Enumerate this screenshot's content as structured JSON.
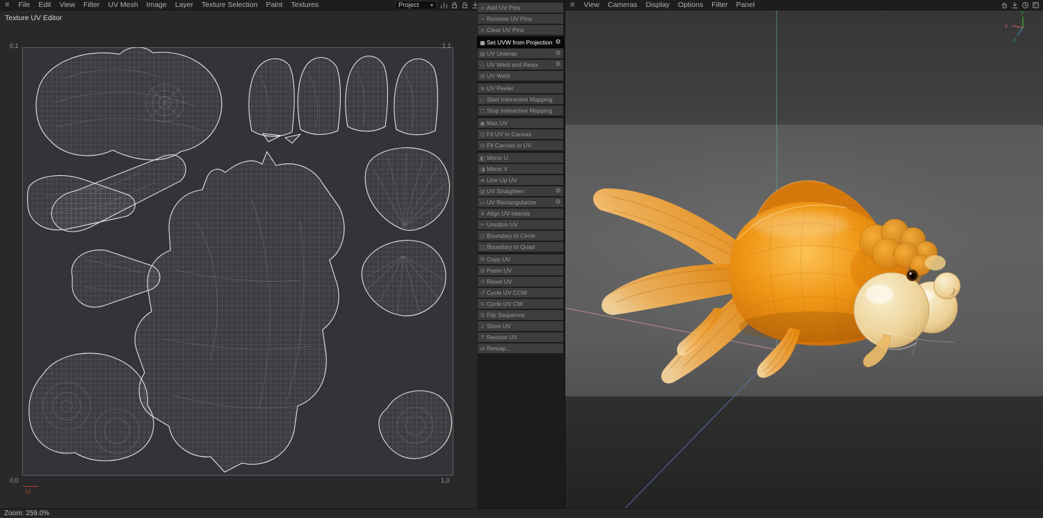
{
  "menubar": {
    "items": [
      "File",
      "Edit",
      "View",
      "Filter",
      "UV Mesh",
      "Image",
      "Layer",
      "Texture Selection",
      "Paint",
      "Textures"
    ]
  },
  "project_select": {
    "value": "Project",
    "caret": "▾"
  },
  "uv_editor": {
    "title": "Texture UV Editor",
    "corner_top_left": "0,1",
    "corner_top_right": "1,1",
    "corner_bottom_left": "0,0",
    "corner_bottom_right": "1,0",
    "axis_u_label": "U"
  },
  "tool_panel": {
    "items": [
      {
        "label": "Add UV Pins",
        "icon": "+"
      },
      {
        "label": "Remove UV Pins",
        "icon": "−"
      },
      {
        "label": "Clear UV Pins",
        "icon": "×"
      },
      {
        "label": "Set UVW from Projection",
        "icon": "▦",
        "gear": true,
        "active": true,
        "sep": true
      },
      {
        "label": "UV Unwrap",
        "icon": "▤",
        "gear": true
      },
      {
        "label": "UV Weld and Relax",
        "icon": "◇",
        "gear": true
      },
      {
        "label": "UV Weld",
        "icon": "⊞"
      },
      {
        "label": "UV Peeler",
        "icon": "≋",
        "sep": true
      },
      {
        "label": "Start Interactive Mapping",
        "icon": "▷"
      },
      {
        "label": "Stop Interactive Mapping",
        "icon": "◻"
      },
      {
        "label": "Max UV",
        "icon": "▣",
        "sep": true
      },
      {
        "label": "Fit UV to Canvas",
        "icon": "⊡"
      },
      {
        "label": "Fit Canvas to UV",
        "icon": "⊟"
      },
      {
        "label": "Mirror U",
        "icon": "◧",
        "sep": true
      },
      {
        "label": "Mirror V",
        "icon": "◨"
      },
      {
        "label": "Line Up UV",
        "icon": "≡"
      },
      {
        "label": "UV Straighten",
        "icon": "▥",
        "gear": true
      },
      {
        "label": "UV Rectangularize",
        "icon": "▭",
        "gear": true
      },
      {
        "label": "Align UV Islands",
        "icon": "#"
      },
      {
        "label": "Unstitch UV",
        "icon": "✂"
      },
      {
        "label": "Boundary to Circle",
        "icon": "○"
      },
      {
        "label": "Boundary to Quad",
        "icon": "□"
      },
      {
        "label": "Copy UV",
        "icon": "⧉",
        "sep": true
      },
      {
        "label": "Paste UV",
        "icon": "⊞"
      },
      {
        "label": "Reset UV",
        "icon": "↺"
      },
      {
        "label": "Cycle UV CCW",
        "icon": "↺"
      },
      {
        "label": "Cycle UV CW",
        "icon": "↻"
      },
      {
        "label": "Flip Sequence",
        "icon": "⇅"
      },
      {
        "label": "Store UV",
        "icon": "↓"
      },
      {
        "label": "Restore UV",
        "icon": "↑"
      },
      {
        "label": "Remap...",
        "icon": "⇄"
      }
    ]
  },
  "viewport": {
    "menu_items": [
      "View",
      "Cameras",
      "Display",
      "Options",
      "Filter",
      "Panel"
    ],
    "gizmo": {
      "x": "X",
      "y": "Y",
      "z": "Z"
    }
  },
  "status_bar": {
    "zoom_text": "Zoom: 259.0%"
  },
  "colors": {
    "selection_bg": "#090909",
    "selection_text": "#ffffff",
    "fish_orange": "#f09816",
    "bubble_cream": "#edd196",
    "axis_x_red": "#e06565",
    "axis_y_green": "#3ecf3e",
    "axis_z_blue": "#3fa9c9",
    "uv_wire": "#e6e6e6"
  }
}
